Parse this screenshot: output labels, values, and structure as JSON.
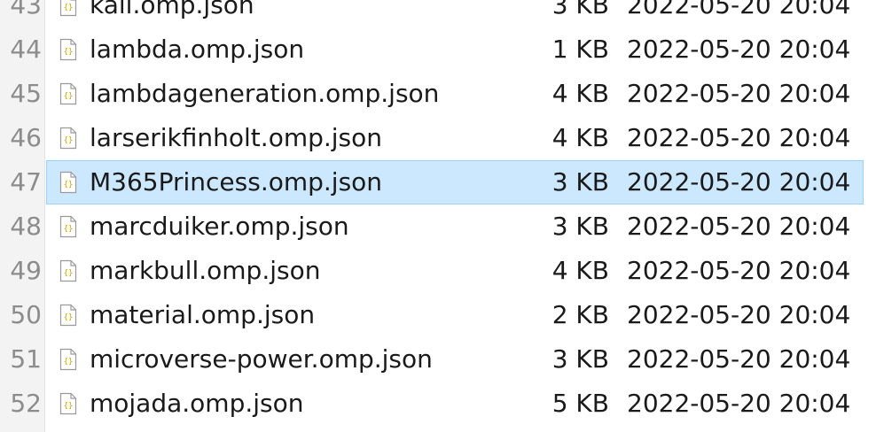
{
  "file_list": {
    "rows": [
      {
        "line": "43",
        "name": "kali.omp.json",
        "size": "3 KB",
        "date": "2022-05-20 20:04",
        "selected": false
      },
      {
        "line": "44",
        "name": "lambda.omp.json",
        "size": "1 KB",
        "date": "2022-05-20 20:04",
        "selected": false
      },
      {
        "line": "45",
        "name": "lambdageneration.omp.json",
        "size": "4 KB",
        "date": "2022-05-20 20:04",
        "selected": false
      },
      {
        "line": "46",
        "name": "larserikfinholt.omp.json",
        "size": "4 KB",
        "date": "2022-05-20 20:04",
        "selected": false
      },
      {
        "line": "47",
        "name": "M365Princess.omp.json",
        "size": "3 KB",
        "date": "2022-05-20 20:04",
        "selected": true
      },
      {
        "line": "48",
        "name": "marcduiker.omp.json",
        "size": "3 KB",
        "date": "2022-05-20 20:04",
        "selected": false
      },
      {
        "line": "49",
        "name": "markbull.omp.json",
        "size": "4 KB",
        "date": "2022-05-20 20:04",
        "selected": false
      },
      {
        "line": "50",
        "name": "material.omp.json",
        "size": "2 KB",
        "date": "2022-05-20 20:04",
        "selected": false
      },
      {
        "line": "51",
        "name": "microverse-power.omp.json",
        "size": "3 KB",
        "date": "2022-05-20 20:04",
        "selected": false
      },
      {
        "line": "52",
        "name": "mojada.omp.json",
        "size": "5 KB",
        "date": "2022-05-20 20:04",
        "selected": false
      }
    ],
    "icon": "json-file-icon",
    "colors": {
      "selection_bg": "#cce8ff",
      "selection_border": "#99d1ff",
      "line_number": "#8c8c8c",
      "gutter_bg": "#f3f3f3"
    }
  }
}
